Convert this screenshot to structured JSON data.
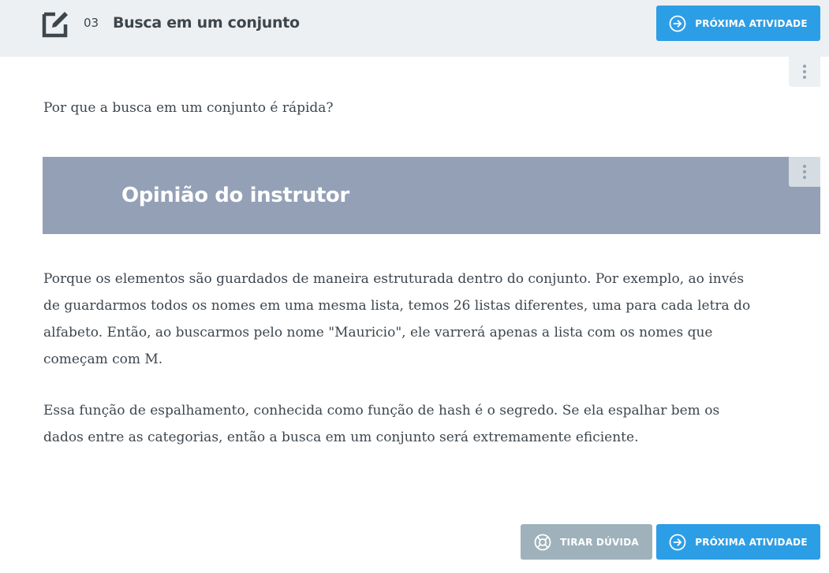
{
  "header": {
    "lesson_number": "03",
    "lesson_title": "Busca em um conjunto",
    "next_button_label": "PRÓXIMA ATIVIDADE",
    "edit_icon": "edit-icon",
    "next_icon": "arrow-right-circle-icon"
  },
  "content": {
    "question": "Por que a busca em um conjunto é rápida?",
    "opinion_title": "Opinião do instrutor",
    "answer_paragraphs": [
      "Porque os elementos são guardados de maneira estruturada dentro do conjunto. Por exemplo, ao invés de guardarmos todos os nomes em uma mesma lista, temos 26 listas diferentes, uma para cada letra do alfabeto. Então, ao buscarmos pelo nome \"Mauricio\", ele varrerá apenas a lista com os nomes que começam com M.",
      "Essa função de espalhamento, conhecida como função de hash é o segredo. Se ela espalhar bem os dados entre as categorias, então a busca em um conjunto será extremamente eficiente."
    ],
    "more_icon": "more-vertical-icon"
  },
  "footer": {
    "help_button_label": "TIRAR DÚVIDA",
    "next_button_label": "PRÓXIMA ATIVIDADE",
    "help_icon": "lifebuoy-icon"
  },
  "colors": {
    "accent": "#2c9ee6",
    "banner": "#94a0b6",
    "topbar": "#edf0f2",
    "help_button": "#9fb1bb",
    "text": "#3d464d"
  }
}
